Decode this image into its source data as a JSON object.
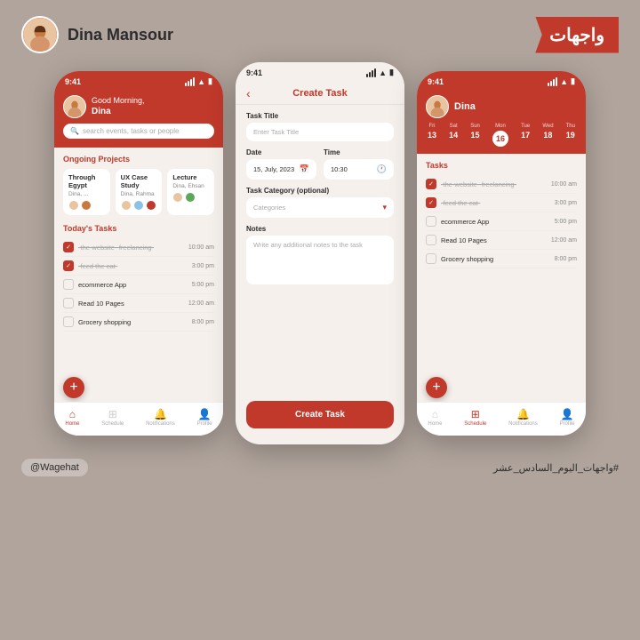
{
  "header": {
    "user_name": "Dina Mansour",
    "logo_text": "واجهات"
  },
  "phone1": {
    "status_time": "9:41",
    "greeting": "Good Morning,",
    "greeting_name": "Dina",
    "search_placeholder": "search events, tasks or people",
    "sections": {
      "projects_title": "Ongoing Projects",
      "tasks_title": "Today's Tasks"
    },
    "projects": [
      {
        "name": "Through Egypt",
        "meta": "Dina, ..."
      },
      {
        "name": "UX Case Study",
        "meta": "Dina, Rahma"
      },
      {
        "name": "Lecture",
        "meta": "Dina, Ehsan"
      }
    ],
    "tasks": [
      {
        "name": "-the-website--freelancing-",
        "time": "10:00 am",
        "done": true
      },
      {
        "name": "-feed the cat-",
        "time": "3:00 pm",
        "done": true
      },
      {
        "name": "ecommerce App",
        "time": "5:00 pm",
        "done": false
      },
      {
        "name": "Read 10 Pages",
        "time": "12:00 am",
        "done": false
      },
      {
        "name": "Grocery shopping",
        "time": "8:00 pm",
        "done": false
      }
    ],
    "nav": [
      {
        "label": "Home",
        "active": true
      },
      {
        "label": "Schedule",
        "active": false
      },
      {
        "label": "Notifications",
        "active": false
      },
      {
        "label": "Profile",
        "active": false
      }
    ],
    "fab_label": "+"
  },
  "phone2": {
    "status_time": "9:41",
    "title": "Create Task",
    "form": {
      "task_title_label": "Task Title",
      "task_title_placeholder": "Enter Task Title",
      "date_label": "Date",
      "date_value": "15, July, 2023",
      "time_label": "Time",
      "time_value": "10:30",
      "category_label": "Task Category (optional)",
      "category_placeholder": "Categories",
      "notes_label": "Notes",
      "notes_placeholder": "Write any additional notes to the task"
    },
    "submit_button": "Create Task"
  },
  "phone3": {
    "status_time": "9:41",
    "user_name": "Dina",
    "calendar": {
      "days": [
        {
          "name": "Fri",
          "num": "13",
          "today": false
        },
        {
          "name": "Sat",
          "num": "14",
          "today": false
        },
        {
          "name": "Sun",
          "num": "15",
          "today": false
        },
        {
          "name": "Mon",
          "num": "16",
          "today": true
        },
        {
          "name": "Tue",
          "num": "17",
          "today": false
        },
        {
          "name": "Wed",
          "num": "18",
          "today": false
        },
        {
          "name": "Thu",
          "num": "19",
          "today": false
        }
      ]
    },
    "tasks_title": "Tasks",
    "tasks": [
      {
        "name": "-the-website--freelancing-",
        "time": "10:00 am",
        "done": true
      },
      {
        "name": "-feed the cat-",
        "time": "3:00 pm",
        "done": true
      },
      {
        "name": "ecommerce App",
        "time": "5:00 pm",
        "done": false
      },
      {
        "name": "Read 10 Pages",
        "time": "12:00 am",
        "done": false
      },
      {
        "name": "Grocery shopping",
        "time": "8:00 pm",
        "done": false
      }
    ],
    "nav": [
      {
        "label": "Home",
        "active": false
      },
      {
        "label": "Schedule",
        "active": true
      },
      {
        "label": "Notifications",
        "active": false
      },
      {
        "label": "Profile",
        "active": false
      }
    ],
    "fab_label": "+"
  },
  "footer": {
    "handle": "@Wagehat",
    "hashtag": "#واجهات_اليوم_السادس_عشر"
  },
  "colors": {
    "primary": "#c0392b",
    "background": "#b0a49c",
    "phone_bg": "#f5f0eb"
  }
}
